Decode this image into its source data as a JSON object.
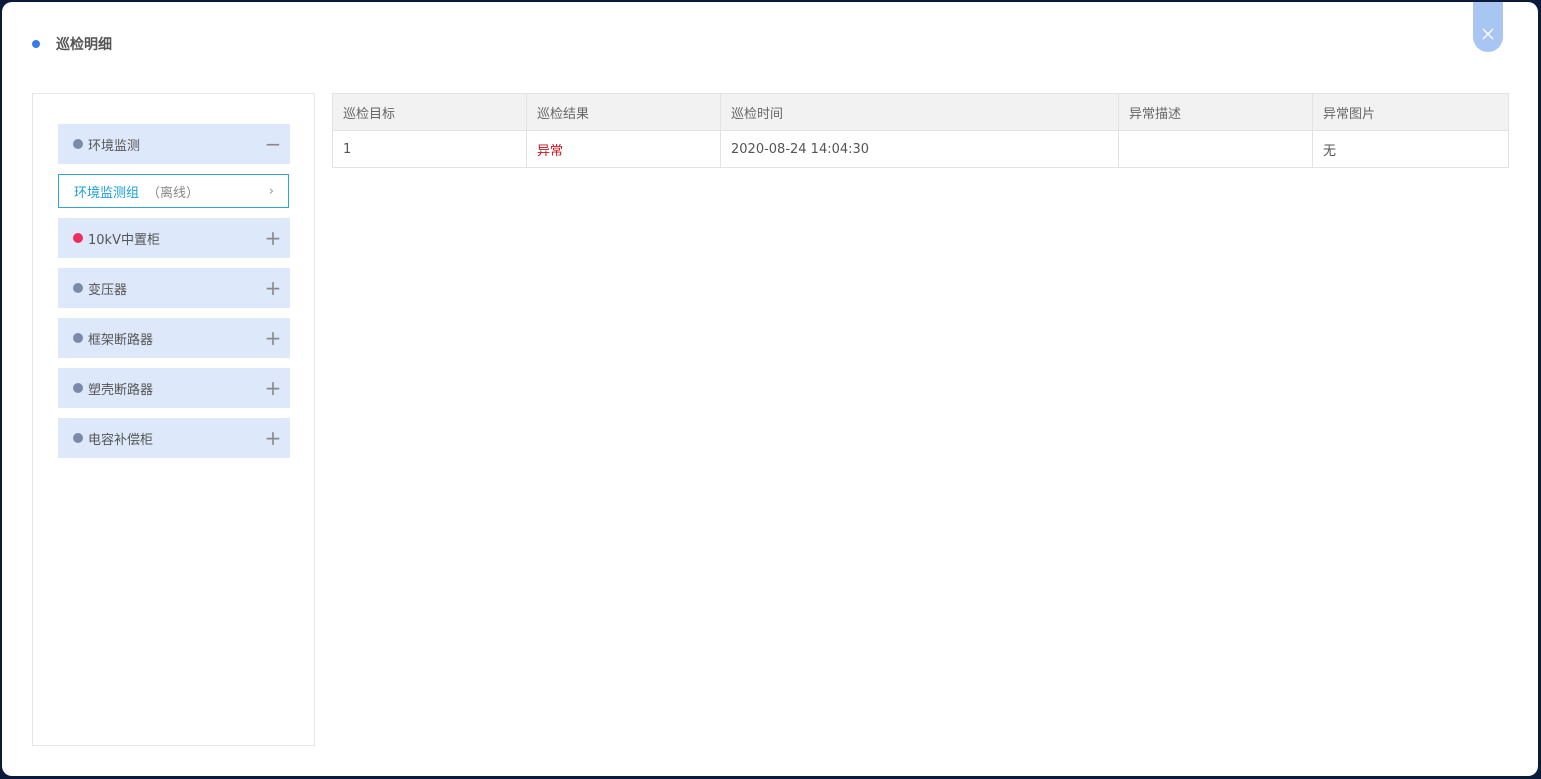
{
  "header": {
    "title": "巡检明细"
  },
  "close": {
    "icon": "close-icon"
  },
  "sidebar": {
    "groups": [
      {
        "label": "环境监测",
        "toggle": "−",
        "dot_color": "#7a8aa8",
        "expanded": true
      },
      {
        "label": "10kV中置柜",
        "toggle": "+",
        "dot_color": "#ee2d5a",
        "expanded": false
      },
      {
        "label": "变压器",
        "toggle": "+",
        "dot_color": "#7a8aa8",
        "expanded": false
      },
      {
        "label": "框架断路器",
        "toggle": "+",
        "dot_color": "#7a8aa8",
        "expanded": false
      },
      {
        "label": "塑壳断路器",
        "toggle": "+",
        "dot_color": "#7a8aa8",
        "expanded": false
      },
      {
        "label": "电容补偿柜",
        "toggle": "+",
        "dot_color": "#7a8aa8",
        "expanded": false
      }
    ],
    "sub_item": {
      "name": "环境监测组",
      "status": "（离线）",
      "chevron": "›"
    }
  },
  "table": {
    "columns": [
      "巡检目标",
      "巡检结果",
      "巡检时间",
      "异常描述",
      "异常图片"
    ],
    "rows": [
      [
        "1",
        "异常",
        "2020-08-24 14:04:30",
        "",
        "无"
      ]
    ]
  }
}
